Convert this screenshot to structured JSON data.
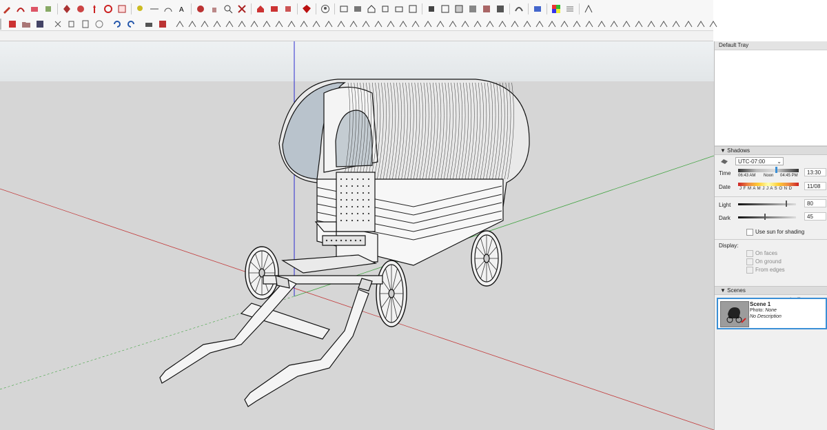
{
  "tray": {
    "title": "Default Tray",
    "shadows": {
      "header": "Shadows",
      "timezone": "UTC-07:00",
      "time_label": "Time",
      "time_start": "06:43 AM",
      "time_noon": "Noon",
      "time_end": "04:45 PM",
      "time_value": "13:30",
      "date_label": "Date",
      "months": "J F M A M J J A S O N D",
      "date_value": "11/08",
      "light_label": "Light",
      "light_value": "80",
      "dark_label": "Dark",
      "dark_value": "45",
      "use_sun_label": "Use sun for shading",
      "display_label": "Display:",
      "on_faces": "On faces",
      "on_ground": "On ground",
      "from_edges": "From edges"
    },
    "scenes": {
      "header": "Scenes",
      "scene_name": "Scene 1",
      "photo_label": "Photo:",
      "photo_value": "None",
      "description": "No Description"
    }
  },
  "colors": {
    "accent": "#3a8fd6",
    "axis_red": "#c23a3a",
    "axis_green": "#3fa33f",
    "axis_blue": "#2b2bd0",
    "sky": "#e9edf0",
    "ground": "#d5d5d5"
  }
}
